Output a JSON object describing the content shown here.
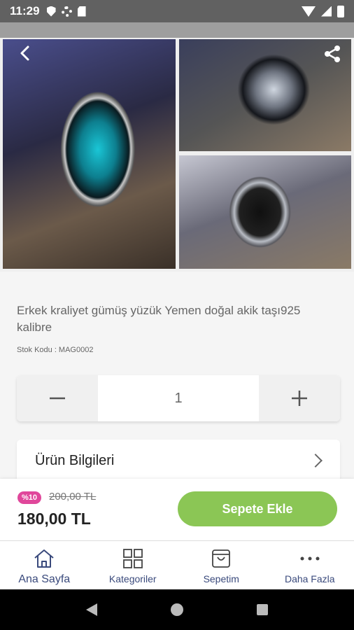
{
  "status_bar": {
    "time": "11:29"
  },
  "product": {
    "title": "Erkek kraliyet gümüş yüzük Yemen doğal akik taşı925 kalibre",
    "sku": "Stok Kodu : MAG0002"
  },
  "quantity": {
    "minus": "−",
    "value": "1",
    "plus": "+"
  },
  "info": {
    "label": "Ürün Bilgileri"
  },
  "pricing": {
    "discount": "%10",
    "old_price": "200,00 TL",
    "new_price": "180,00 TL",
    "add_to_cart": "Sepete Ekle"
  },
  "nav": {
    "items": [
      {
        "label": "Ana Sayfa",
        "icon": "home-icon"
      },
      {
        "label": "Kategoriler",
        "icon": "grid-icon"
      },
      {
        "label": "Sepetim",
        "icon": "cart-icon"
      },
      {
        "label": "Daha Fazla",
        "icon": "more-icon"
      }
    ]
  },
  "colors": {
    "accent_green": "#8bc655",
    "discount_pink": "#e0479b",
    "nav_blue": "#3a4a7c"
  }
}
